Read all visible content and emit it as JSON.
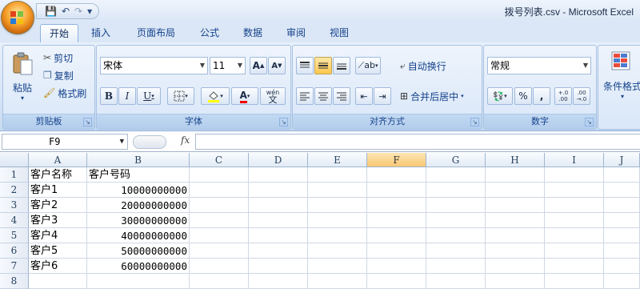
{
  "window": {
    "title": "拨号列表.csv - Microsoft Excel"
  },
  "qat": {
    "save": "💾",
    "undo": "↶",
    "redo": "↷",
    "customize": "▾"
  },
  "tabs": [
    "开始",
    "插入",
    "页面布局",
    "公式",
    "数据",
    "审阅",
    "视图"
  ],
  "ribbon": {
    "clipboard": {
      "label": "剪贴板",
      "paste": "粘贴",
      "cut": "剪切",
      "copy": "复制",
      "format_painter": "格式刷"
    },
    "font": {
      "label": "字体",
      "font_name": "宋体",
      "font_size": "11",
      "grow": "A",
      "shrink": "A",
      "bold": "B",
      "italic": "I",
      "underline": "U",
      "phonetic": "wén"
    },
    "alignment": {
      "label": "对齐方式",
      "wrap": "自动换行",
      "merge": "合并后居中"
    },
    "number": {
      "label": "数字",
      "format": "常规",
      "percent": "%",
      "comma": ",",
      "inc_decimal": "+.0 .00",
      "dec_decimal": ".00 →.0"
    },
    "styles": {
      "conditional": "条件格式"
    }
  },
  "formula_bar": {
    "name_box": "F9",
    "fx": "fx",
    "value": ""
  },
  "sheet": {
    "columns": [
      "A",
      "B",
      "C",
      "D",
      "E",
      "F",
      "G",
      "H",
      "I",
      "J"
    ],
    "selected_column": "F",
    "rows": [
      {
        "num": "1",
        "a": "客户名称",
        "b": "客户号码"
      },
      {
        "num": "2",
        "a": "客户1",
        "b": "10000000000"
      },
      {
        "num": "3",
        "a": "客户2",
        "b": "20000000000"
      },
      {
        "num": "4",
        "a": "客户3",
        "b": "30000000000"
      },
      {
        "num": "5",
        "a": "客户4",
        "b": "40000000000"
      },
      {
        "num": "6",
        "a": "客户5",
        "b": "50000000000"
      },
      {
        "num": "7",
        "a": "客户6",
        "b": "60000000000"
      },
      {
        "num": "8",
        "a": "",
        "b": ""
      }
    ]
  }
}
